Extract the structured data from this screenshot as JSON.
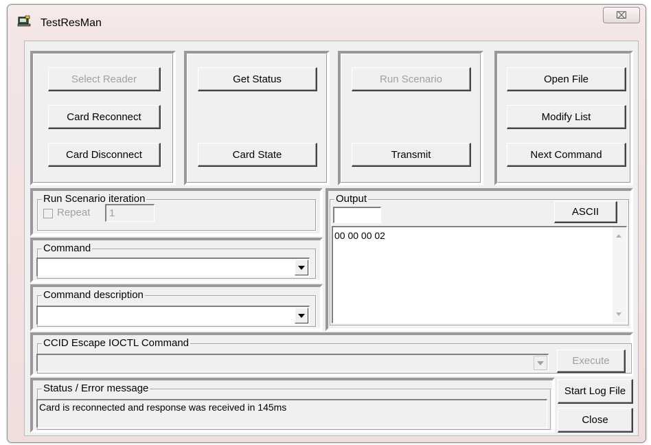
{
  "window": {
    "title": "TestResMan",
    "close_glyph": "⌧"
  },
  "panel1": {
    "select_reader": "Select Reader",
    "card_reconnect": "Card Reconnect",
    "card_disconnect": "Card Disconnect"
  },
  "panel2": {
    "get_status": "Get Status",
    "card_state": "Card State"
  },
  "panel3": {
    "run_scenario": "Run Scenario",
    "transmit": "Transmit"
  },
  "panel4": {
    "open_file": "Open File",
    "modify_list": "Modify List",
    "next_command": "Next Command"
  },
  "run_scenario_iteration": {
    "label": "Run Scenario iteration",
    "repeat_label": "Repeat",
    "repeat_value": "1"
  },
  "command": {
    "label": "Command",
    "value": ""
  },
  "command_description": {
    "label": "Command description",
    "value": ""
  },
  "output": {
    "label": "Output",
    "ascii_button": "ASCII",
    "small_field": "",
    "text": "00 00 00 02"
  },
  "ccid": {
    "label": "CCID Escape IOCTL Command",
    "value": "",
    "execute_button": "Execute"
  },
  "status": {
    "label": "Status / Error message",
    "message": "Card is reconnected and response was received in 145ms"
  },
  "buttons": {
    "start_log": "Start Log File",
    "close": "Close"
  },
  "icons": {
    "app": "card-reader-icon",
    "close": "close-icon",
    "combo": "chevron-down-icon"
  }
}
